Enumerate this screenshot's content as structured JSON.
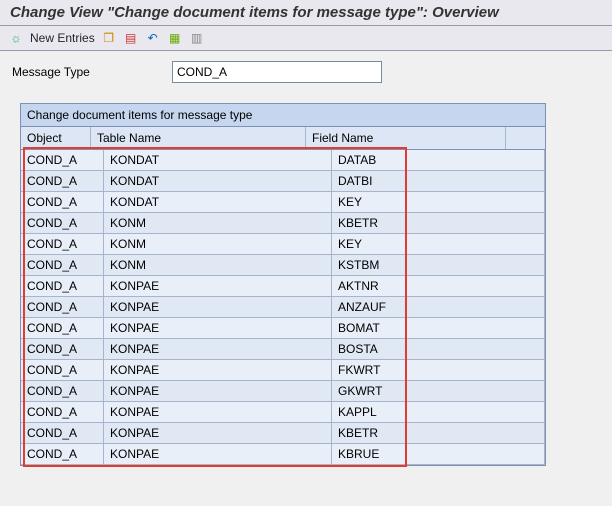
{
  "title": "Change View \"Change document items for message type\": Overview",
  "toolbar": {
    "new_entries_label": "New Entries"
  },
  "form": {
    "message_type_label": "Message Type",
    "message_type_value": "COND_A"
  },
  "table": {
    "title": "Change document items for message type",
    "columns": {
      "object": "Object",
      "table_name": "Table Name",
      "field_name": "Field Name"
    },
    "rows": [
      {
        "object": "COND_A",
        "table": "KONDAT",
        "field": "DATAB"
      },
      {
        "object": "COND_A",
        "table": "KONDAT",
        "field": "DATBI"
      },
      {
        "object": "COND_A",
        "table": "KONDAT",
        "field": "KEY"
      },
      {
        "object": "COND_A",
        "table": "KONM",
        "field": "KBETR"
      },
      {
        "object": "COND_A",
        "table": "KONM",
        "field": "KEY"
      },
      {
        "object": "COND_A",
        "table": "KONM",
        "field": "KSTBM"
      },
      {
        "object": "COND_A",
        "table": "KONPAE",
        "field": "AKTNR"
      },
      {
        "object": "COND_A",
        "table": "KONPAE",
        "field": "ANZAUF"
      },
      {
        "object": "COND_A",
        "table": "KONPAE",
        "field": "BOMAT"
      },
      {
        "object": "COND_A",
        "table": "KONPAE",
        "field": "BOSTA"
      },
      {
        "object": "COND_A",
        "table": "KONPAE",
        "field": "FKWRT"
      },
      {
        "object": "COND_A",
        "table": "KONPAE",
        "field": "GKWRT"
      },
      {
        "object": "COND_A",
        "table": "KONPAE",
        "field": "KAPPL"
      },
      {
        "object": "COND_A",
        "table": "KONPAE",
        "field": "KBETR"
      },
      {
        "object": "COND_A",
        "table": "KONPAE",
        "field": "KBRUE"
      }
    ]
  }
}
